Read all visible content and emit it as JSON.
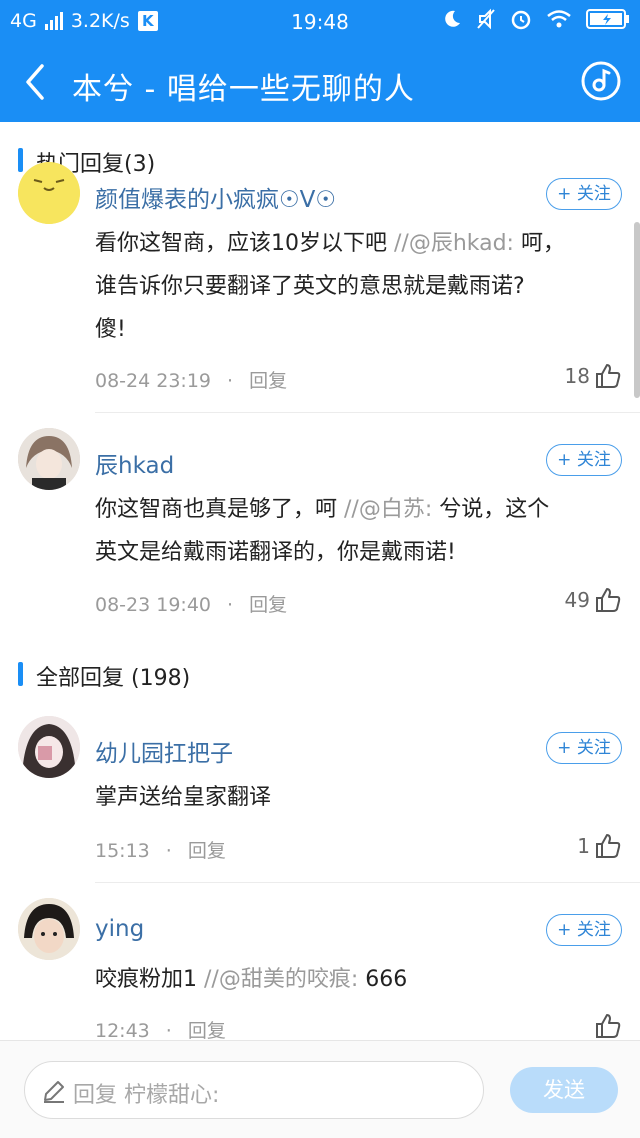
{
  "status_bar": {
    "network": "4G",
    "speed": "3.2K/s",
    "k_badge": "K",
    "time": "19:48"
  },
  "nav": {
    "title": "本兮 - 唱给一些无聊的人"
  },
  "hot_section": {
    "title": "热门回复(3)",
    "comments": [
      {
        "username": "颜值爆表的小疯疯☉Ⅴ☉",
        "follow": "+ 关注",
        "line1_main": "看你这智商，应该10岁以下吧",
        "line1_quote": " //@辰hkad:",
        "line1_tail": " 呵，",
        "line2": "谁告诉你只要翻译了英文的意思就是戴雨诺?",
        "line3": "傻!",
        "date": "08-24 23:19",
        "dot": "·",
        "reply": "回复",
        "likes": "18"
      },
      {
        "username": "辰hkad",
        "follow": "+ 关注",
        "line1_main": "你这智商也真是够了，呵",
        "line1_quote": " //@白苏:",
        "line1_tail": " 兮说，这个",
        "line2": "英文是给戴雨诺翻译的，你是戴雨诺!",
        "date": "08-23 19:40",
        "dot": "·",
        "reply": "回复",
        "likes": "49"
      }
    ]
  },
  "all_section": {
    "title": "全部回复 (198)",
    "comments": [
      {
        "username": "幼儿园扛把子",
        "follow": "+ 关注",
        "text": "掌声送给皇家翻译",
        "date": "15:13",
        "dot": "·",
        "reply": "回复",
        "likes": "1"
      },
      {
        "username": "ying",
        "follow": "+ 关注",
        "text_main": "咬痕粉加1",
        "text_quote": " //@甜美的咬痕:",
        "text_tail": " 666",
        "date": "12:43",
        "dot": "·",
        "reply": "回复",
        "likes": ""
      }
    ]
  },
  "bottom_bar": {
    "placeholder": "回复 柠檬甜心:",
    "send": "发送"
  },
  "colors": {
    "brand": "#1a8ef5",
    "username": "#3b6fa6",
    "send_disabled": "#b9dcfa"
  },
  "icons": [
    "back-arrow-icon",
    "music-note-icon",
    "thumbs-up-icon",
    "pencil-icon",
    "moon-icon",
    "mute-icon",
    "alarm-icon",
    "wifi-icon",
    "battery-icon"
  ]
}
